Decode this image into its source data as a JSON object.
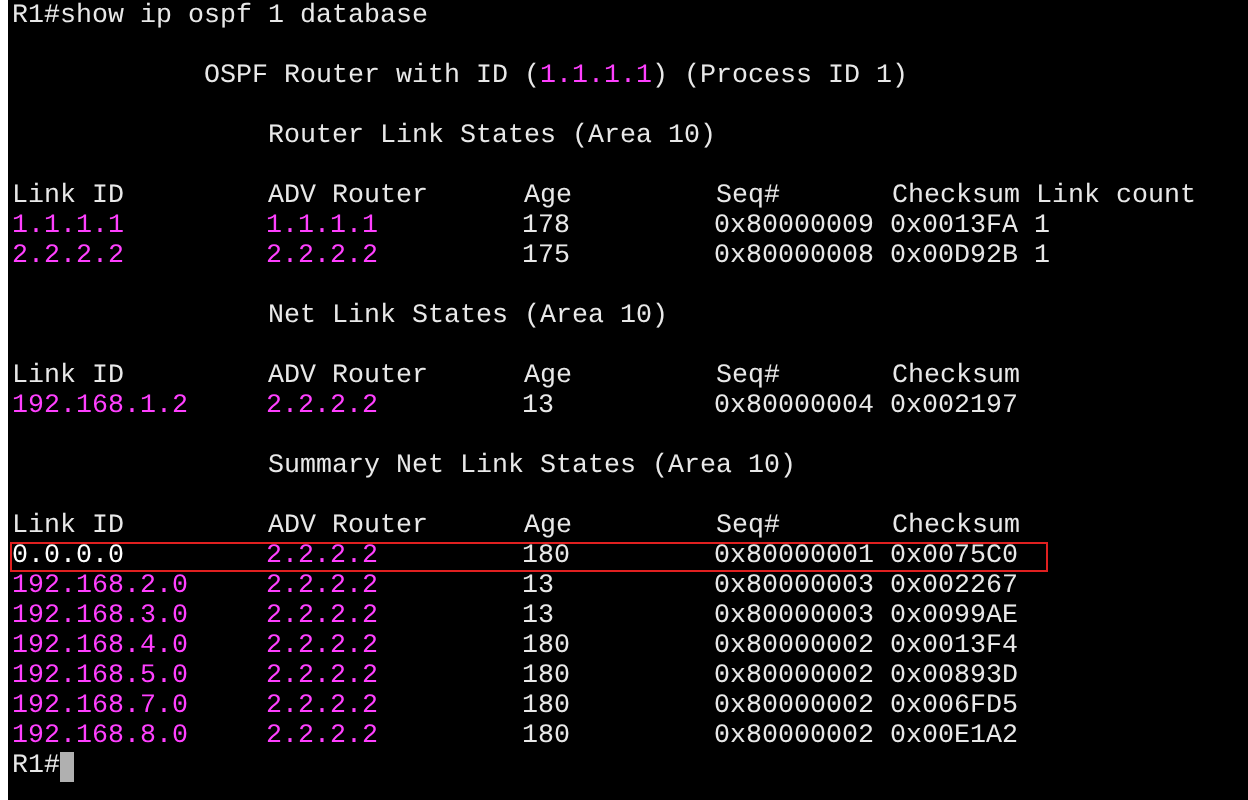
{
  "command_line": {
    "prompt": "R1#",
    "command": "show ip ospf 1 database"
  },
  "banner": {
    "prefix": "OSPF Router with ID (",
    "router_id": "1.1.1.1",
    "suffix": ") (Process ID 1)"
  },
  "sections": [
    {
      "heading": "Router Link States (Area 10)",
      "columns": [
        "Link ID",
        "ADV Router",
        "Age",
        "Seq#",
        "Checksum",
        "Link count"
      ],
      "rows": [
        {
          "cells": [
            "1.1.1.1",
            "1.1.1.1",
            "178",
            "0x80000009",
            "0x0013FA",
            "1"
          ],
          "color": "#ff40ff",
          "highlighted": false
        },
        {
          "cells": [
            "2.2.2.2",
            "2.2.2.2",
            "175",
            "0x80000008",
            "0x00D92B",
            "1"
          ],
          "color": "#ff40ff",
          "highlighted": false
        }
      ]
    },
    {
      "heading": "Net Link States (Area 10)",
      "columns": [
        "Link ID",
        "ADV Router",
        "Age",
        "Seq#",
        "Checksum"
      ],
      "rows": [
        {
          "cells": [
            "192.168.1.2",
            "2.2.2.2",
            "13",
            "0x80000004",
            "0x002197"
          ],
          "color": "#ff40ff",
          "highlighted": false
        }
      ]
    },
    {
      "heading": "Summary Net Link States (Area 10)",
      "columns": [
        "Link ID",
        "ADV Router",
        "Age",
        "Seq#",
        "Checksum"
      ],
      "rows": [
        {
          "cells": [
            "0.0.0.0",
            "2.2.2.2",
            "180",
            "0x80000001",
            "0x0075C0"
          ],
          "color": "#ffffff",
          "highlighted": true
        },
        {
          "cells": [
            "192.168.2.0",
            "2.2.2.2",
            "13",
            "0x80000003",
            "0x002267"
          ],
          "color": "#ff40ff",
          "highlighted": false
        },
        {
          "cells": [
            "192.168.3.0",
            "2.2.2.2",
            "13",
            "0x80000003",
            "0x0099AE"
          ],
          "color": "#ff40ff",
          "highlighted": false
        },
        {
          "cells": [
            "192.168.4.0",
            "2.2.2.2",
            "180",
            "0x80000002",
            "0x0013F4"
          ],
          "color": "#ff40ff",
          "highlighted": false
        },
        {
          "cells": [
            "192.168.5.0",
            "2.2.2.2",
            "180",
            "0x80000002",
            "0x00893D"
          ],
          "color": "#ff40ff",
          "highlighted": false
        },
        {
          "cells": [
            "192.168.7.0",
            "2.2.2.2",
            "180",
            "0x80000002",
            "0x006FD5"
          ],
          "color": "#ff40ff",
          "highlighted": false
        },
        {
          "cells": [
            "192.168.8.0",
            "2.2.2.2",
            "180",
            "0x80000002",
            "0x00E1A2"
          ],
          "color": "#ff40ff",
          "highlighted": false
        }
      ]
    }
  ],
  "prompt": "R1#"
}
